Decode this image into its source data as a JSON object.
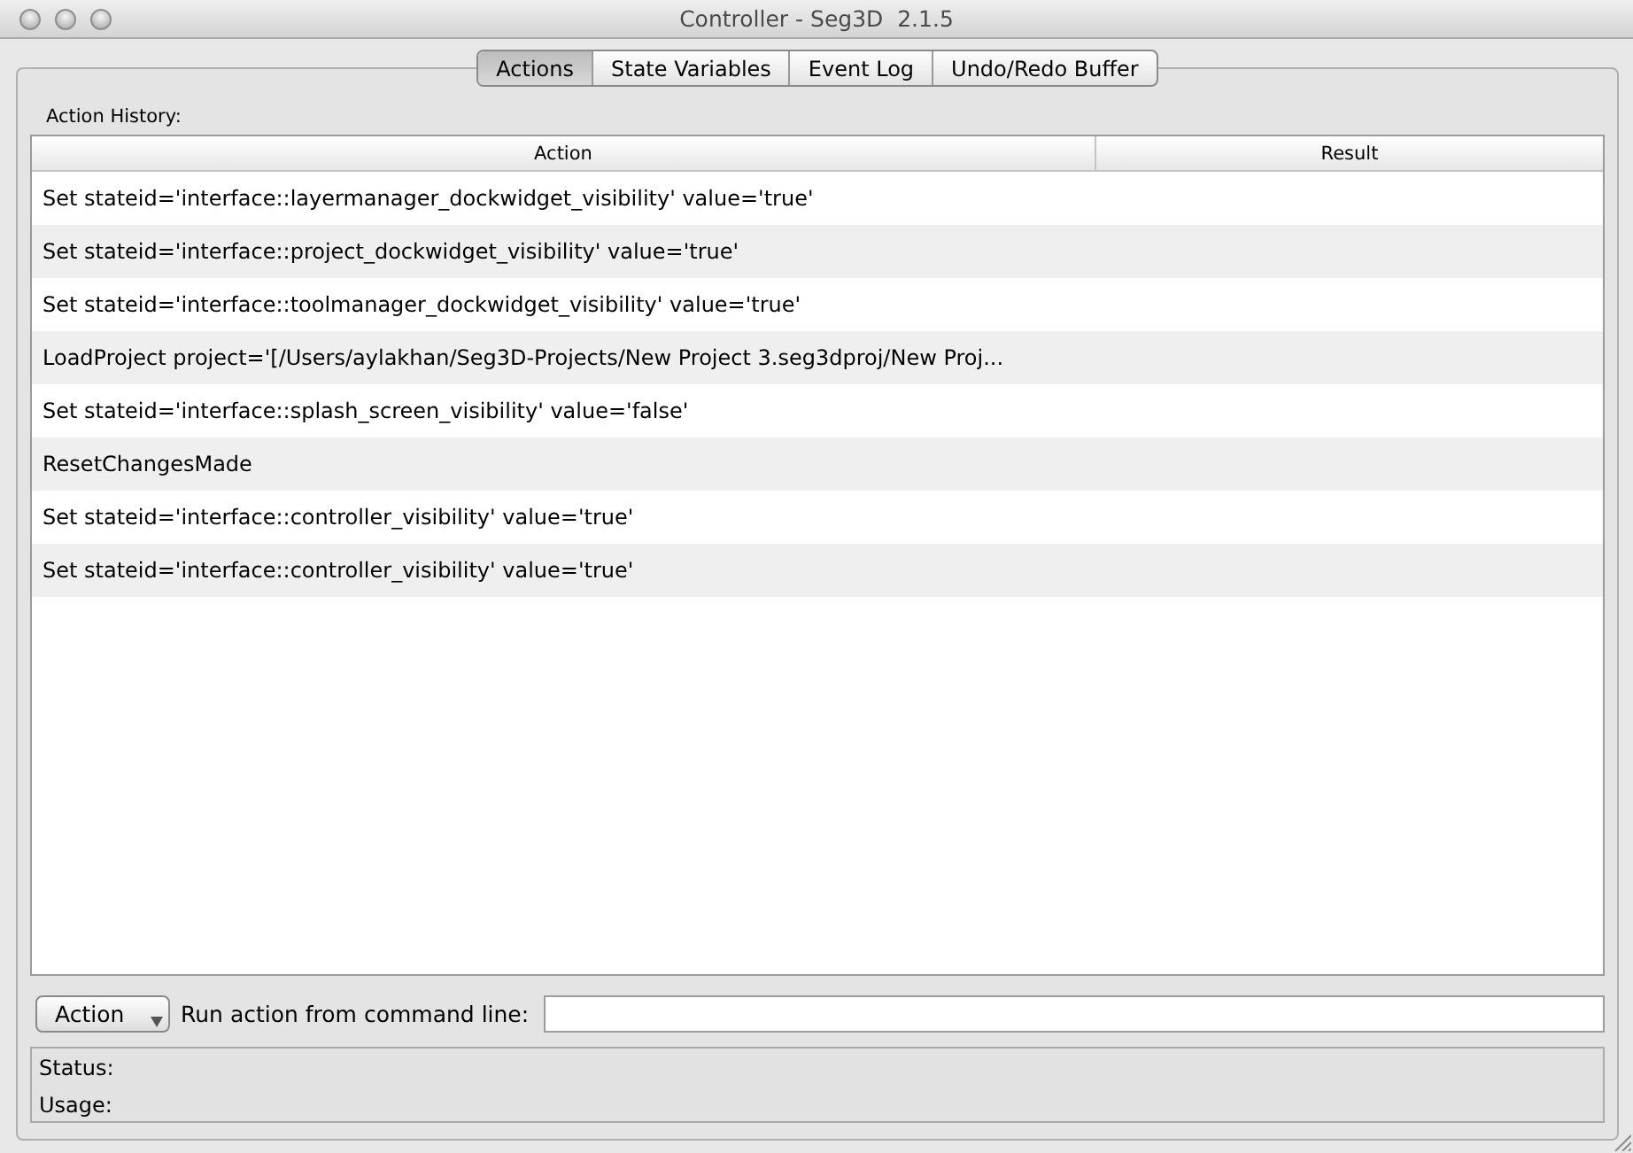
{
  "window": {
    "title": "Controller - Seg3D  2.1.5"
  },
  "tabs": [
    {
      "label": "Actions",
      "selected": true
    },
    {
      "label": "State Variables",
      "selected": false
    },
    {
      "label": "Event Log",
      "selected": false
    },
    {
      "label": "Undo/Redo Buffer",
      "selected": false
    }
  ],
  "action_history": {
    "label": "Action History:",
    "columns": [
      "Action",
      "Result"
    ],
    "rows": [
      {
        "action": "Set stateid='interface::layermanager_dockwidget_visibility' value='true'"
      },
      {
        "action": "Set stateid='interface::project_dockwidget_visibility' value='true'"
      },
      {
        "action": "Set stateid='interface::toolmanager_dockwidget_visibility' value='true'"
      },
      {
        "action": "LoadProject project='[/Users/aylakhan/Seg3D-Projects/New Project 3.seg3dproj/New Proj..."
      },
      {
        "action": "Set stateid='interface::splash_screen_visibility' value='false'"
      },
      {
        "action": "ResetChangesMade"
      },
      {
        "action": "Set stateid='interface::controller_visibility' value='true'"
      },
      {
        "action": "Set stateid='interface::controller_visibility' value='true'"
      }
    ]
  },
  "command_line": {
    "button": "Action",
    "label": "Run action from command line:"
  },
  "status_panel": {
    "status_label": "Status:",
    "usage_label": "Usage:"
  }
}
